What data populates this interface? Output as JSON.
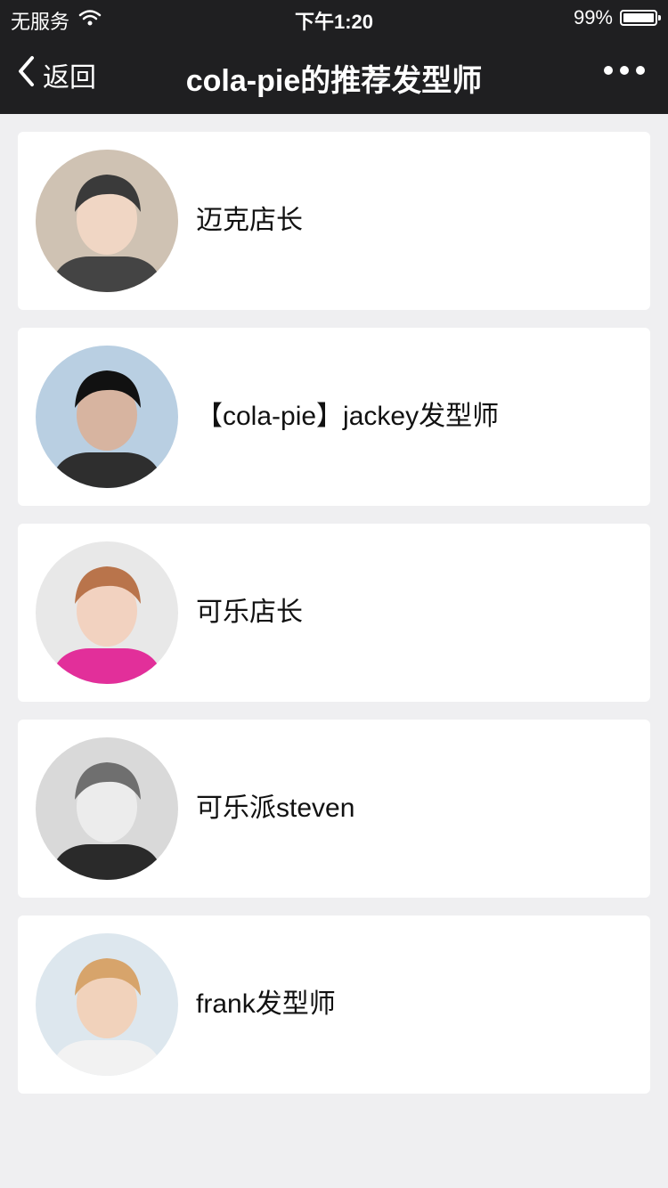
{
  "status_bar": {
    "carrier": "无服务",
    "time": "下午1:20",
    "battery_percent": "99%",
    "battery_level": 0.99
  },
  "nav": {
    "back_label": "返回",
    "title": "cola-pie的推荐发型师",
    "more_icon": "more-dots-icon"
  },
  "stylists": [
    {
      "name": "迈克店长",
      "avatar": {
        "bg": "#cfc2b3",
        "skin": "#f0d6c4",
        "hair": "#3a3a3a",
        "shirt": "#444"
      }
    },
    {
      "name": "【cola-pie】jackey发型师",
      "avatar": {
        "bg": "#b9cfe2",
        "skin": "#d7b4a0",
        "hair": "#111111",
        "shirt": "#2e2e2e"
      }
    },
    {
      "name": "可乐店长",
      "avatar": {
        "bg": "#e8e8e8",
        "skin": "#f2d2c0",
        "hair": "#b9744b",
        "shirt": "#e22f9a"
      }
    },
    {
      "name": "可乐派steven",
      "avatar": {
        "bg": "#d9d9d9",
        "skin": "#ececec",
        "hair": "#6f6f6f",
        "shirt": "#2a2a2a"
      }
    },
    {
      "name": "frank发型师",
      "avatar": {
        "bg": "#dde7ee",
        "skin": "#f1d2bb",
        "hair": "#d7a46b",
        "shirt": "#f2f2f2"
      }
    }
  ],
  "colors": {
    "header_bg": "#1f1f21",
    "page_bg": "#efeff1",
    "card_bg": "#ffffff"
  }
}
